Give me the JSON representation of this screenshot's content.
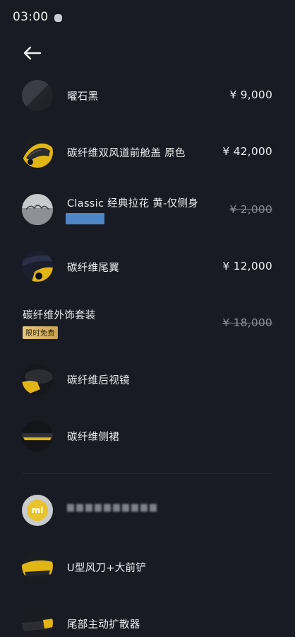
{
  "status_bar": {
    "time": "03:00"
  },
  "items": [
    {
      "title": "曜石黑",
      "price": "¥ 9,000",
      "struck": false,
      "thumb": "obsidian-black-swatch"
    },
    {
      "title": "碳纤维双风道前舱盖 原色",
      "price": "¥ 42,000",
      "struck": false,
      "thumb": "carbon-hood-photo"
    },
    {
      "title": "Classic 经典拉花 黄-仅侧身",
      "price": "¥ 2,000",
      "struck": true,
      "thumb": "classic-decal-photo"
    },
    {
      "title": "碳纤维尾翼",
      "price": "¥ 12,000",
      "struck": false,
      "thumb": "carbon-spoiler-photo"
    },
    {
      "title": "碳纤维外饰套装",
      "price": "¥ 18,000",
      "struck": true,
      "badge": "限时免费"
    },
    {
      "title": "碳纤维后视镜",
      "thumb": "carbon-mirror-photo"
    },
    {
      "title": "碳纤维侧裙",
      "thumb": "carbon-side-skirt-photo"
    },
    {
      "title": "",
      "thumb": "mi-logo"
    },
    {
      "title": "U型风刀+大前铲",
      "thumb": "front-splitter-photo"
    },
    {
      "title": "尾部主动扩散器",
      "thumb": "rear-diffuser-photo"
    }
  ],
  "colors": {
    "background": "#181b23",
    "badge_gold": "#d8b466",
    "strike_gray": "#8a8d96",
    "blue_tag": "#4f86c6",
    "accent_yellow": "#f2c218"
  }
}
